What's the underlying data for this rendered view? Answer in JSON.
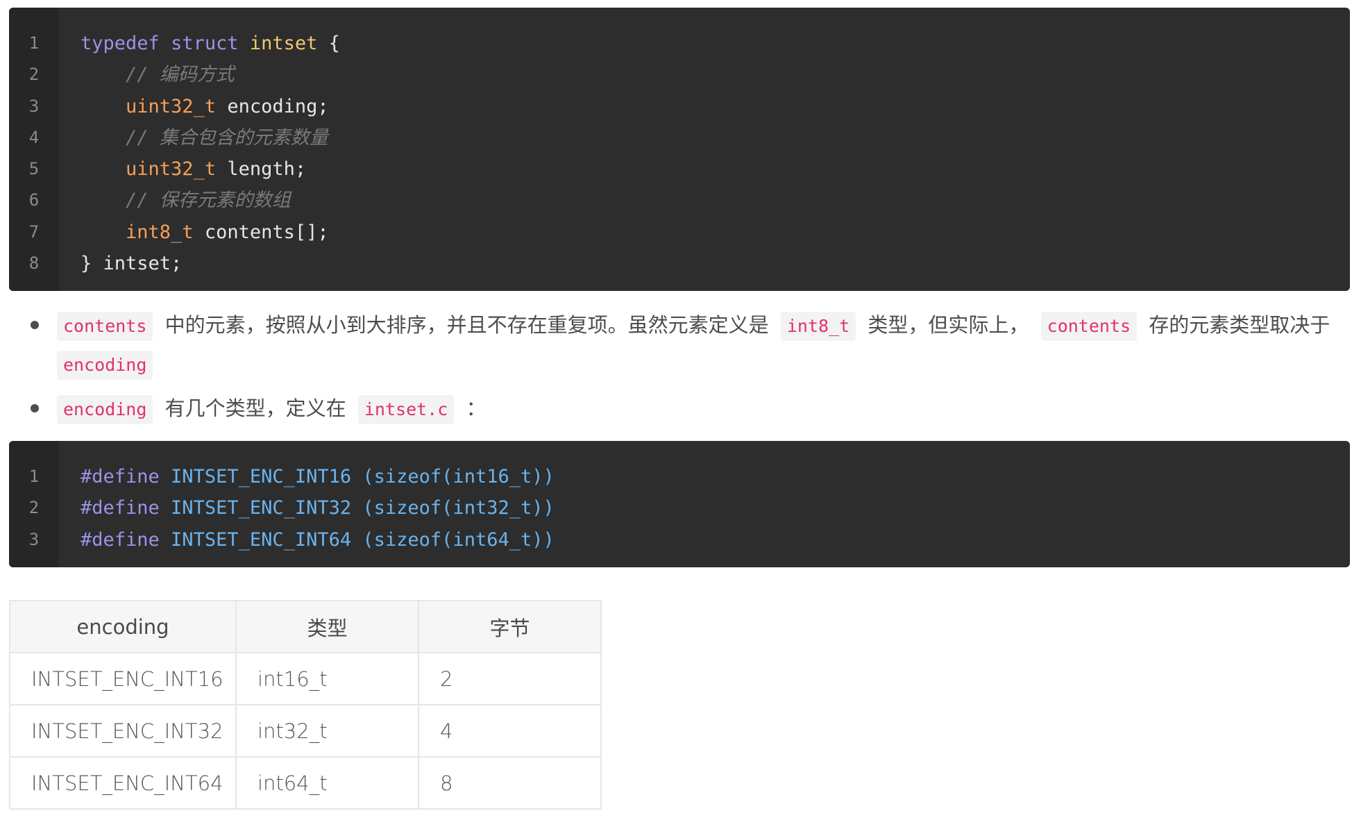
{
  "code_block_1": {
    "line_numbers": [
      "1",
      "2",
      "3",
      "4",
      "5",
      "6",
      "7",
      "8"
    ],
    "lines": [
      [
        {
          "text": "typedef",
          "cls": "k"
        },
        {
          "text": " "
        },
        {
          "text": "struct",
          "cls": "k"
        },
        {
          "text": " "
        },
        {
          "text": "intset",
          "cls": "t"
        },
        {
          "text": " {"
        }
      ],
      [
        {
          "text": "    "
        },
        {
          "text": "// 编码方式",
          "cls": "cm"
        }
      ],
      [
        {
          "text": "    "
        },
        {
          "text": "uint32_t",
          "cls": "ty"
        },
        {
          "text": " encoding;"
        }
      ],
      [
        {
          "text": "    "
        },
        {
          "text": "// 集合包含的元素数量",
          "cls": "cm"
        }
      ],
      [
        {
          "text": "    "
        },
        {
          "text": "uint32_t",
          "cls": "ty"
        },
        {
          "text": " length;"
        }
      ],
      [
        {
          "text": "    "
        },
        {
          "text": "// 保存元素的数组",
          "cls": "cm"
        }
      ],
      [
        {
          "text": "    "
        },
        {
          "text": "int8_t",
          "cls": "ty"
        },
        {
          "text": " contents[];"
        }
      ],
      [
        {
          "text": "} intset;"
        }
      ]
    ]
  },
  "bullets": {
    "b1": {
      "code1": "contents",
      "text1": "中的元素，按照从小到大排序，并且不存在重复项。虽然元素定义是",
      "code2": "int8_t",
      "text2": "类型，但实际上，",
      "code3": "contents",
      "text3": "存的元素类型取决于",
      "code4": "encoding"
    },
    "b2": {
      "code1": "encoding",
      "text1": "有几个类型，定义在",
      "code2": "intset.c",
      "text2": "："
    }
  },
  "code_block_2": {
    "line_numbers": [
      "1",
      "2",
      "3"
    ],
    "lines": [
      [
        {
          "text": "#define",
          "cls": "k"
        },
        {
          "text": " INTSET_ENC_INT16 (sizeof(int16_t))",
          "cls": "pp"
        }
      ],
      [
        {
          "text": "#define",
          "cls": "k"
        },
        {
          "text": " INTSET_ENC_INT32 (sizeof(int32_t))",
          "cls": "pp"
        }
      ],
      [
        {
          "text": "#define",
          "cls": "k"
        },
        {
          "text": " INTSET_ENC_INT64 (sizeof(int64_t))",
          "cls": "pp"
        }
      ]
    ]
  },
  "table": {
    "headers": {
      "encoding": "encoding",
      "type": "类型",
      "bytes": "字节"
    },
    "rows": [
      {
        "encoding": "INTSET_ENC_INT16",
        "type": "int16_t",
        "bytes": "2"
      },
      {
        "encoding": "INTSET_ENC_INT32",
        "type": "int32_t",
        "bytes": "4"
      },
      {
        "encoding": "INTSET_ENC_INT64",
        "type": "int64_t",
        "bytes": "8"
      }
    ]
  }
}
